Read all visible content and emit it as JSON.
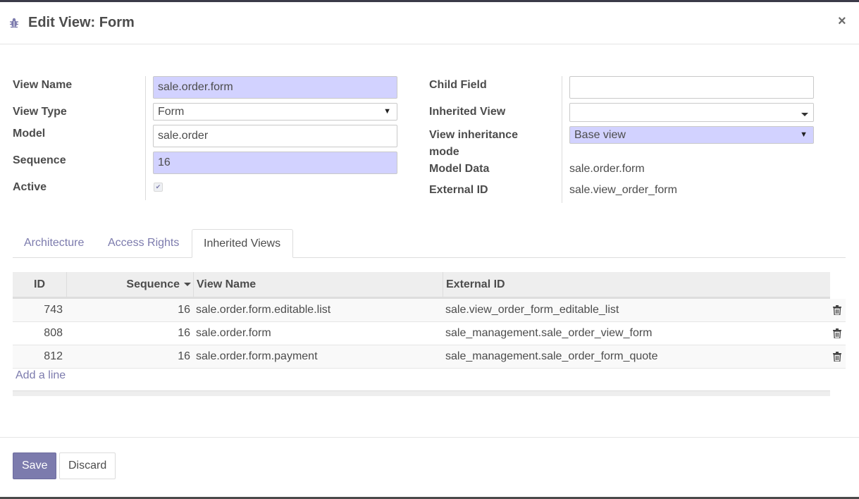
{
  "dialog": {
    "title": "Edit View: Form",
    "close_symbol": "×"
  },
  "form": {
    "left": {
      "view_name_label": "View Name",
      "view_name_value": "sale.order.form",
      "view_type_label": "View Type",
      "view_type_value": "Form",
      "model_label": "Model",
      "model_value": "sale.order",
      "sequence_label": "Sequence",
      "sequence_value": "16",
      "active_label": "Active",
      "active_checked": true
    },
    "right": {
      "child_field_label": "Child Field",
      "child_field_value": "",
      "inherited_view_label": "Inherited View",
      "inherited_view_value": "",
      "inheritance_mode_label_1": "View inheritance",
      "inheritance_mode_label_2": "mode",
      "inheritance_mode_value": "Base view",
      "model_data_label": "Model Data",
      "model_data_value": "sale.order.form",
      "external_id_label": "External ID",
      "external_id_value": "sale.view_order_form"
    }
  },
  "tabs": [
    {
      "label": "Architecture",
      "active": false
    },
    {
      "label": "Access Rights",
      "active": false
    },
    {
      "label": "Inherited Views",
      "active": true
    }
  ],
  "table": {
    "columns": [
      "ID",
      "Sequence",
      "View Name",
      "External ID"
    ],
    "rows": [
      {
        "id": "743",
        "sequence": "16",
        "view_name": "sale.order.form.editable.list",
        "external_id": "sale.view_order_form_editable_list"
      },
      {
        "id": "808",
        "sequence": "16",
        "view_name": "sale.order.form",
        "external_id": "sale_management.sale_order_view_form"
      },
      {
        "id": "812",
        "sequence": "16",
        "view_name": "sale.order.form.payment",
        "external_id": "sale_management.sale_order_form_quote"
      }
    ],
    "add_line_label": "Add a line"
  },
  "footer": {
    "save_label": "Save",
    "discard_label": "Discard"
  },
  "colors": {
    "accent": "#7c7bad",
    "required_field_bg": "#d2d2ff",
    "header_strip": "#3a3a48"
  },
  "icons": {
    "title_icon": "bug-icon",
    "row_delete_icon": "trash-icon"
  }
}
